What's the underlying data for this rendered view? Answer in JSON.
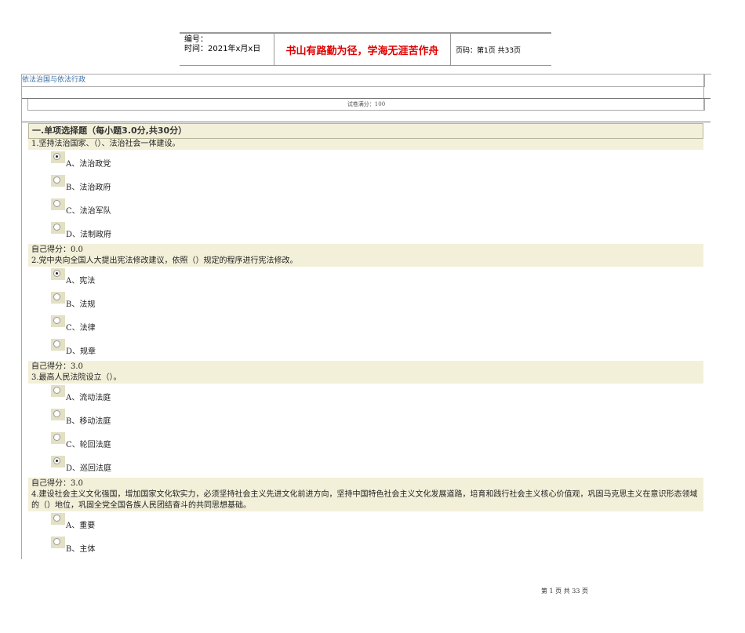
{
  "header": {
    "number_label": "编号：",
    "date_label": "时间：2021年x月x日",
    "motto": "书山有路勤为径，学海无涯苦作舟",
    "page_code": "页码：第1页 共33页"
  },
  "exam": {
    "title": "依法治国与依法行政",
    "full_score": "试卷满分：100",
    "section": "一.单项选择题（每小题3.0分,共30分）"
  },
  "questions": [
    {
      "text": "1.坚持法治国家、（）、法治社会一体建设。",
      "options": [
        "A、法治政党",
        "B、法治政府",
        "C、法治军队",
        "D、法制政府"
      ],
      "selected": 0,
      "score": "自己得分：0.0"
    },
    {
      "text": "2.党中央向全国人大提出宪法修改建议，依照（）规定的程序进行宪法修改。",
      "options": [
        "A、宪法",
        "B、法规",
        "C、法律",
        "D、规章"
      ],
      "selected": 0,
      "score": "自己得分：3.0"
    },
    {
      "text": "3.最高人民法院设立（）。",
      "options": [
        "A、流动法庭",
        "B、移动法庭",
        "C、轮回法庭",
        "D、巡回法庭"
      ],
      "selected": 3,
      "score": "自己得分：3.0"
    },
    {
      "text": "4.建设社会主义文化强国，增加国家文化软实力，必须坚持社会主义先进文化前进方向，坚持中国特色社会主义文化发展道路，培育和践行社会主义核心价值观，巩固马克思主义在意识形态领域的（）地位，巩固全党全国各族人民团结奋斗的共同思想基础。",
      "options": [
        "A、重要",
        "B、主体"
      ],
      "selected": -1
    }
  ],
  "footer": "第 1 页 共 33 页",
  "colors": {
    "motto": "#e00000",
    "row_bg": "#f3f0d9",
    "title_link": "#3a6ea5"
  }
}
